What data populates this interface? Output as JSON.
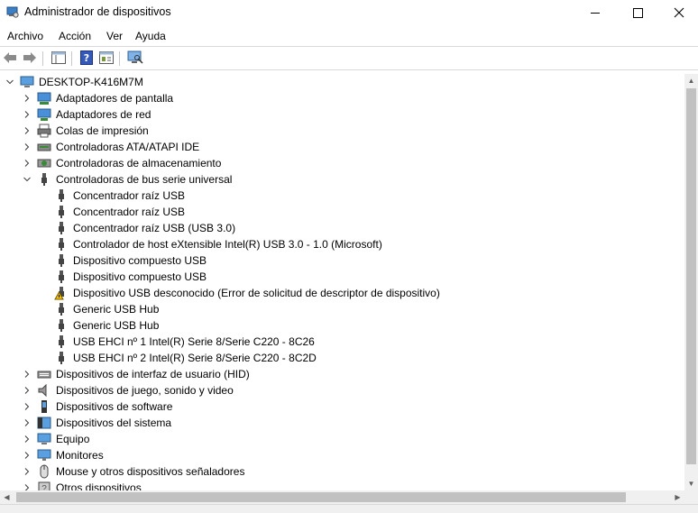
{
  "window": {
    "title": "Administrador de dispositivos",
    "controls": [
      "minimize-icon",
      "maximize-icon",
      "close-icon"
    ]
  },
  "menu": [
    "Archivo",
    "Acción",
    "Ver",
    "Ayuda"
  ],
  "toolbar": [
    "back-icon",
    "forward-icon",
    "show-hide-console-tree-icon",
    "help-icon",
    "properties-icon",
    "scan-hardware-icon"
  ],
  "tree": {
    "computer": "DESKTOP-K416M7M",
    "categories_before": [
      {
        "label": "Adaptadores de pantalla",
        "icon": "display-adapter-icon"
      },
      {
        "label": "Adaptadores de red",
        "icon": "network-adapter-icon"
      },
      {
        "label": "Colas de impresión",
        "icon": "print-queue-icon"
      },
      {
        "label": "Controladoras ATA/ATAPI IDE",
        "icon": "ide-controller-icon"
      },
      {
        "label": "Controladoras de almacenamiento",
        "icon": "storage-controller-icon"
      }
    ],
    "expanded": {
      "label": "Controladoras de bus serie universal",
      "icon": "usb-icon",
      "children": [
        {
          "label": "Concentrador raíz USB",
          "icon": "usb-icon"
        },
        {
          "label": "Concentrador raíz USB",
          "icon": "usb-icon"
        },
        {
          "label": "Concentrador raíz USB (USB 3.0)",
          "icon": "usb-icon"
        },
        {
          "label": "Controlador de host eXtensible Intel(R) USB 3.0 - 1.0 (Microsoft)",
          "icon": "usb-icon"
        },
        {
          "label": "Dispositivo compuesto USB",
          "icon": "usb-icon"
        },
        {
          "label": "Dispositivo compuesto USB",
          "icon": "usb-icon"
        },
        {
          "label": "Dispositivo USB desconocido (Error de solicitud de descriptor de dispositivo)",
          "icon": "usb-warning-icon"
        },
        {
          "label": "Generic USB Hub",
          "icon": "usb-icon"
        },
        {
          "label": "Generic USB Hub",
          "icon": "usb-icon"
        },
        {
          "label": "USB EHCI nº 1 Intel(R) Serie 8/Serie C220 - 8C26",
          "icon": "usb-icon"
        },
        {
          "label": "USB EHCI nº 2 Intel(R) Serie 8/Serie C220 - 8C2D",
          "icon": "usb-icon"
        }
      ]
    },
    "categories_after": [
      {
        "label": "Dispositivos de interfaz de usuario (HID)",
        "icon": "hid-icon"
      },
      {
        "label": "Dispositivos de juego, sonido y video",
        "icon": "sound-icon"
      },
      {
        "label": "Dispositivos de software",
        "icon": "software-device-icon"
      },
      {
        "label": "Dispositivos del sistema",
        "icon": "system-device-icon"
      },
      {
        "label": "Equipo",
        "icon": "computer-icon"
      },
      {
        "label": "Monitores",
        "icon": "monitor-icon"
      },
      {
        "label": "Mouse y otros dispositivos señaladores",
        "icon": "mouse-icon"
      },
      {
        "label": "Otros dispositivos",
        "icon": "other-devices-icon"
      }
    ]
  }
}
